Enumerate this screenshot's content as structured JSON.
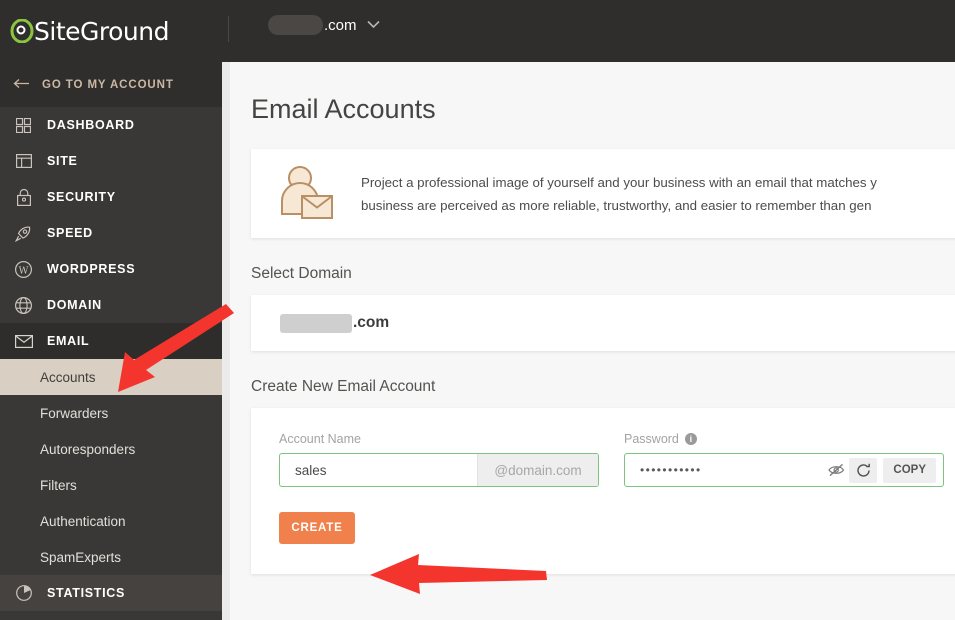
{
  "topbar": {
    "brand": "SiteGround",
    "domain_redacted": true,
    "domain_tld": ".com",
    "chevron_icon": "chevron-down-icon"
  },
  "sidebar": {
    "back_link": {
      "label": "GO TO MY ACCOUNT",
      "icon": "arrow-left-icon"
    },
    "items": [
      {
        "label": "DASHBOARD",
        "icon": "grid-icon"
      },
      {
        "label": "SITE",
        "icon": "window-layout-icon"
      },
      {
        "label": "SECURITY",
        "icon": "lock-icon"
      },
      {
        "label": "SPEED",
        "icon": "rocket-icon"
      },
      {
        "label": "WORDPRESS",
        "icon": "wordpress-icon"
      },
      {
        "label": "DOMAIN",
        "icon": "globe-icon"
      },
      {
        "label": "EMAIL",
        "icon": "envelope-icon",
        "active": true
      }
    ],
    "email_submenu": [
      {
        "label": "Accounts",
        "selected": true
      },
      {
        "label": "Forwarders",
        "selected": false
      },
      {
        "label": "Autoresponders",
        "selected": false
      },
      {
        "label": "Filters",
        "selected": false
      },
      {
        "label": "Authentication",
        "selected": false
      },
      {
        "label": "SpamExperts",
        "selected": false
      }
    ],
    "statistics": {
      "label": "STATISTICS",
      "icon": "pie-chart-icon"
    }
  },
  "main": {
    "page_title": "Email Accounts",
    "banner": {
      "icon": "person-with-envelope-icon",
      "line1": "Project a professional image of yourself and your business with an email that matches y",
      "line2": "business are perceived as more reliable, trustworthy, and easier to remember than gen"
    },
    "select_domain": {
      "label": "Select Domain",
      "value_redacted": true,
      "value_tld": ".com"
    },
    "create_account": {
      "section_label": "Create New Email Account",
      "account_name": {
        "label": "Account Name",
        "value": "sales",
        "suffix": "@domain.com"
      },
      "password": {
        "label": "Password",
        "info_icon": "info-icon",
        "value": "•••••••••••",
        "hide_icon": "eye-off-icon",
        "regenerate_icon": "refresh-icon",
        "copy_label": "COPY"
      },
      "create_label": "CREATE"
    }
  },
  "annotations": {
    "accent_color": "#f0804c",
    "arrow_color": "#f4352e",
    "arrow_accounts_target": "Accounts",
    "arrow_create_target": "CREATE"
  }
}
